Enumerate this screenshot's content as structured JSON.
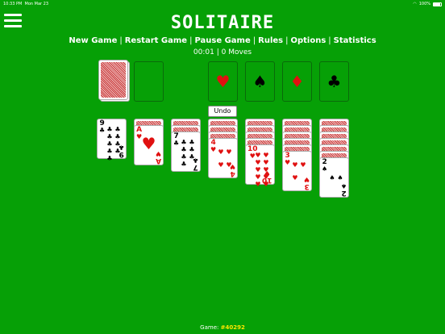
{
  "status": {
    "time": "10:33 PM",
    "date": "Mon Mar 23",
    "battery": "100%"
  },
  "title": "SOLITAIRE",
  "nav": {
    "new_game": "New Game",
    "restart_game": "Restart Game",
    "pause_game": "Pause Game",
    "rules": "Rules",
    "options": "Options",
    "statistics": "Statistics",
    "separator": "|"
  },
  "timer": {
    "time": "00:01",
    "moves": "0 Moves",
    "separator": "|"
  },
  "undo_label": "Undo",
  "foundations": [
    {
      "suit": "♥",
      "color": "red"
    },
    {
      "suit": "♠",
      "color": "black"
    },
    {
      "suit": "♦",
      "color": "red"
    },
    {
      "suit": "♣",
      "color": "black"
    }
  ],
  "tableau": [
    {
      "face_down": 0,
      "top": {
        "rank": "9",
        "suit": "♣",
        "color": "black"
      }
    },
    {
      "face_down": 1,
      "top": {
        "rank": "A",
        "suit": "♥",
        "color": "red"
      }
    },
    {
      "face_down": 2,
      "top": {
        "rank": "7",
        "suit": "♣",
        "color": "black"
      }
    },
    {
      "face_down": 3,
      "top": {
        "rank": "4",
        "suit": "♥",
        "color": "red"
      }
    },
    {
      "face_down": 4,
      "top": {
        "rank": "10",
        "suit": "♥",
        "color": "red"
      }
    },
    {
      "face_down": 5,
      "top": {
        "rank": "3",
        "suit": "♥",
        "color": "red"
      }
    },
    {
      "face_down": 6,
      "top": {
        "rank": "2",
        "suit": "♠",
        "color": "black"
      }
    }
  ],
  "footer": {
    "label": "Game:",
    "number": "#40292"
  },
  "colors": {
    "felt": "#06a006",
    "red_suit": "#e01010",
    "game_number": "#ffe600"
  }
}
